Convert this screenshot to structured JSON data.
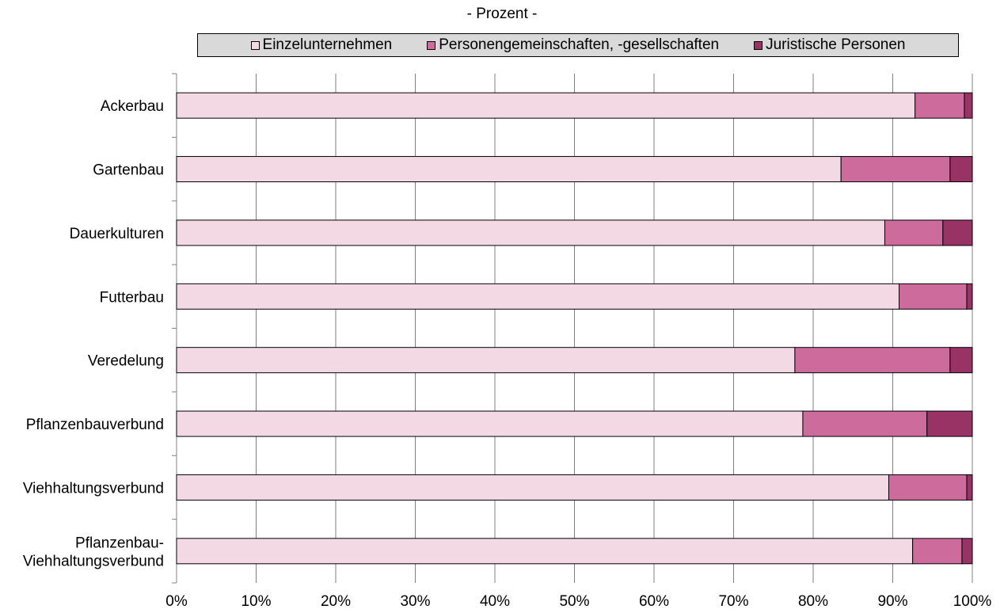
{
  "chart_data": {
    "type": "bar",
    "orientation": "horizontal",
    "stacked": true,
    "subtitle": "- Prozent -",
    "categories": [
      [
        "Ackerbau"
      ],
      [
        "Gartenbau"
      ],
      [
        "Dauerkulturen"
      ],
      [
        "Futterbau"
      ],
      [
        "Veredelung"
      ],
      [
        "Pflanzenbauverbund"
      ],
      [
        "Viehhaltungsverbund"
      ],
      [
        "Pflanzenbau-",
        "Viehhaltungsverbund"
      ]
    ],
    "series": [
      {
        "name": "Einzelunternehmen",
        "color": "#f2d9e3",
        "values": [
          92.8,
          83.5,
          89.0,
          90.8,
          77.7,
          78.7,
          89.5,
          92.5
        ]
      },
      {
        "name": "Personengemeinschaften, -gesellschaften",
        "color": "#cc6b9c",
        "values": [
          6.2,
          13.7,
          7.3,
          8.5,
          19.5,
          15.6,
          9.8,
          6.2
        ]
      },
      {
        "name": "Juristische Personen",
        "color": "#993366",
        "values": [
          1.0,
          2.8,
          3.7,
          0.7,
          2.8,
          5.7,
          0.7,
          1.3
        ]
      }
    ],
    "xlim": [
      0,
      100
    ],
    "xticks": [
      "0%",
      "10%",
      "20%",
      "30%",
      "40%",
      "50%",
      "60%",
      "70%",
      "80%",
      "90%",
      "100%"
    ],
    "grid": true,
    "legend_position": "top"
  }
}
